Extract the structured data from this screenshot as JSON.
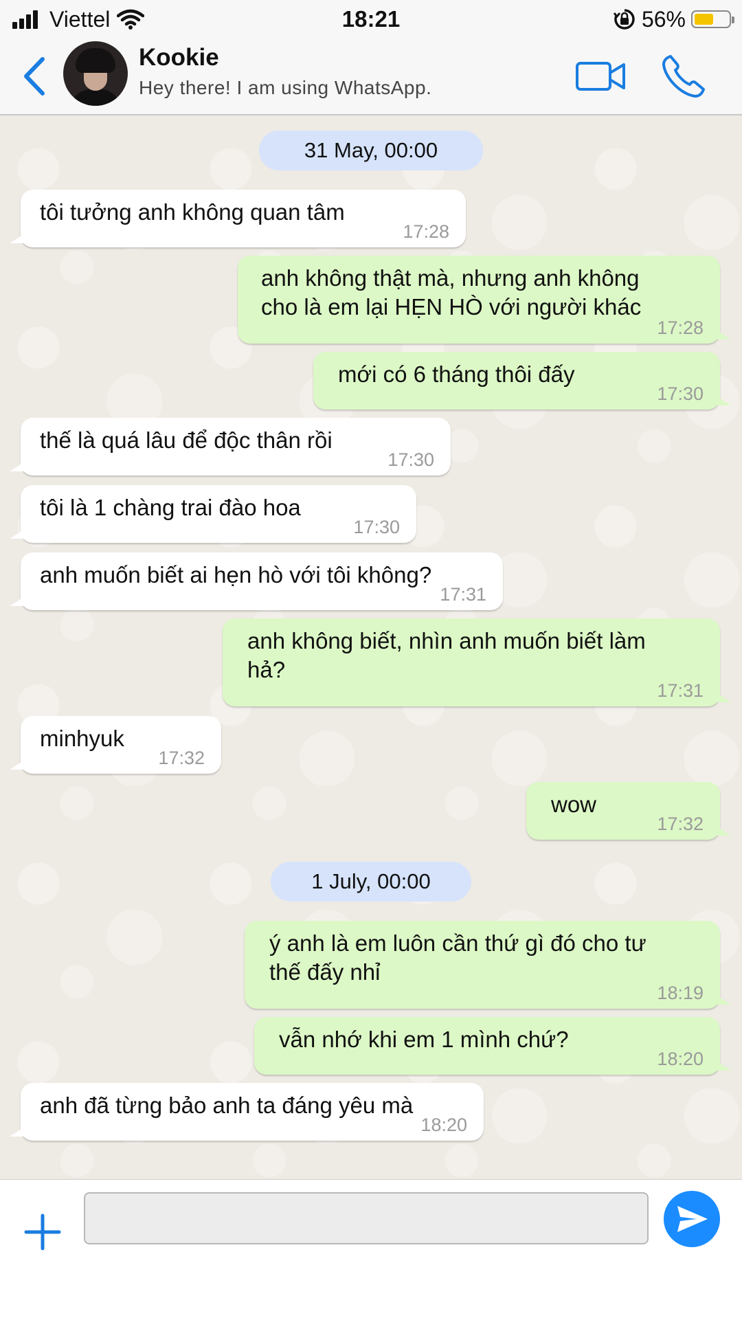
{
  "status_bar": {
    "carrier": "Viettel",
    "time": "18:21",
    "battery_text": "56%",
    "battery_level": 0.56,
    "battery_color": "#f5c400",
    "icons": [
      "signal-icon",
      "wifi-icon",
      "orientation-lock-icon",
      "battery-icon"
    ]
  },
  "header": {
    "contact_name": "Kookie",
    "contact_status": "Hey there! I am using WhatsApp.",
    "icons": [
      "back-chevron-icon",
      "avatar",
      "video-camera-icon",
      "phone-icon"
    ],
    "accent_color": "#1a7de0"
  },
  "chat": {
    "date_separators": [
      "31 May, 00:00",
      "1 July, 00:00"
    ],
    "messages": [
      {
        "dir": "in",
        "text": "tôi tưởng anh không quan tâm",
        "time": "17:28"
      },
      {
        "dir": "out",
        "text": "anh không thật mà, nhưng anh không\ncho là em lại HẸN HÒ với người khác",
        "time": "17:28"
      },
      {
        "dir": "out",
        "text": "mới có 6 tháng thôi đấy",
        "time": "17:30"
      },
      {
        "dir": "in",
        "text": "thế là quá lâu để độc thân rồi",
        "time": "17:30"
      },
      {
        "dir": "in",
        "text": "tôi là 1 chàng trai đào hoa",
        "time": "17:30"
      },
      {
        "dir": "in",
        "text": "anh muốn biết ai hẹn hò với tôi không?",
        "time": "17:31"
      },
      {
        "dir": "out",
        "text": "anh không biết, nhìn anh muốn biết làm\nhả?",
        "time": "17:31"
      },
      {
        "dir": "in",
        "text": "minhyuk",
        "time": "17:32"
      },
      {
        "dir": "out",
        "text": "wow",
        "time": "17:32"
      },
      {
        "dir": "out",
        "text": "ý anh là em luôn cần thứ gì đó cho tư\nthế đấy nhỉ",
        "time": "18:19"
      },
      {
        "dir": "out",
        "text": "vẫn nhớ khi em 1 mình chứ?",
        "time": "18:20"
      },
      {
        "dir": "in",
        "text": "anh đã từng bảo anh ta đáng yêu mà",
        "time": "18:20"
      }
    ],
    "incoming_color": "#ffffff",
    "outgoing_color": "#dcf8c6",
    "date_pill_color": "#d6e3fb"
  },
  "composer": {
    "value": "",
    "placeholder": "",
    "icons": [
      "plus-icon",
      "send-icon"
    ],
    "send_color": "#1a8cff"
  }
}
